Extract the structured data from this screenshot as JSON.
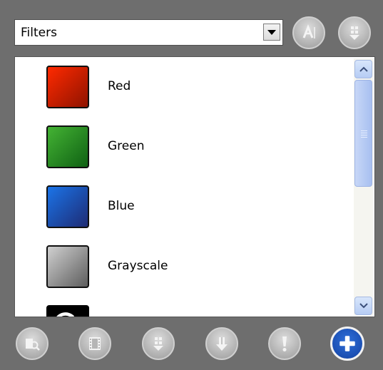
{
  "filters_dropdown": {
    "selected": "Filters"
  },
  "list": {
    "items": [
      {
        "label": "Red",
        "color_top": "#ff2a00",
        "color_bottom": "#8f1300"
      },
      {
        "label": "Green",
        "color_top": "#44b334",
        "color_bottom": "#0f6113"
      },
      {
        "label": "Blue",
        "color_top": "#1b74e8",
        "color_bottom": "#1e2b74"
      },
      {
        "label": "Grayscale",
        "color_top": "#d0d0d0",
        "color_bottom": "#5d5d5d"
      },
      {
        "label": "",
        "color_top": "#000000",
        "color_bottom": "#000000"
      }
    ]
  },
  "toolbar_icons": [
    "text-tool-icon",
    "move-down-icon",
    "search-layer-icon",
    "film-strip-icon",
    "move-down-alt-icon",
    "arrow-down-icon",
    "alert-icon",
    "add-icon"
  ]
}
